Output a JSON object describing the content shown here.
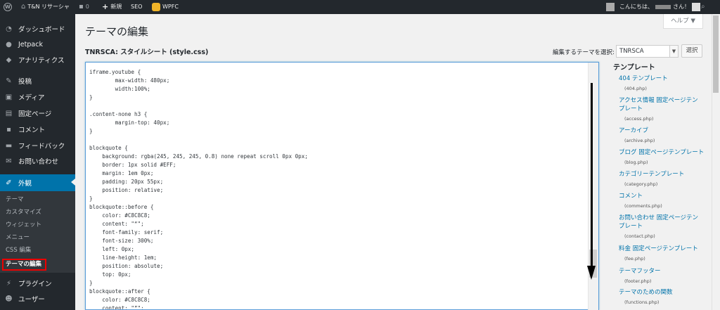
{
  "adminbar": {
    "site_name": "T&N リサーシャ",
    "comments_count": "0",
    "new_label": "新規",
    "seo_label": "SEO",
    "wpfc_label": "WPFC",
    "greeting": "こんにちは、",
    "greeting_suffix": "さん！"
  },
  "sidebar": {
    "dashboard": "ダッシュボード",
    "jetpack": "Jetpack",
    "analytics": "アナリティクス",
    "posts": "投稿",
    "media": "メディア",
    "pages": "固定ページ",
    "comments": "コメント",
    "feedback": "フィードバック",
    "contact": "お問い合わせ",
    "appearance": "外観",
    "sub": [
      "テーマ",
      "カスタマイズ",
      "ウィジェット",
      "メニュー",
      "CSS 編集",
      "テーマの編集"
    ],
    "plugins": "プラグイン",
    "users": "ユーザー"
  },
  "main": {
    "title": "テーマの編集",
    "help": "ヘルプ ▼",
    "file_heading": "TNRSCA: スタイルシート (style.css)",
    "select_label": "編集するテーマを選択:",
    "selected_theme": "TNRSCA",
    "select_button": "選択"
  },
  "editor": {
    "lines": [
      "iframe.youtube {",
      "        max-width: 480px;",
      "        width:100%;",
      "}",
      "",
      ".content-none h3 {",
      "        margin-top: 40px;",
      "}",
      "",
      "blockquote {",
      "    background: rgba(245, 245, 245, 0.8) none repeat scroll 0px 0px;",
      "    border: 1px solid #EFF;",
      "    margin: 1em 0px;",
      "    padding: 20px 55px;",
      "    position: relative;",
      "}",
      "blockquote::before {",
      "    color: #C8C8C8;",
      "    content: \"“\";",
      "    font-family: serif;",
      "    font-size: 300%;",
      "    left: 0px;",
      "    line-height: 1em;",
      "    position: absolute;",
      "    top: 0px;",
      "}",
      "blockquote::after {",
      "    color: #C8C8C8;",
      "    content: \"”\";"
    ]
  },
  "templates": {
    "heading": "テンプレート",
    "items": [
      {
        "name": "404 テンプレート",
        "file": "(404.php)"
      },
      {
        "name": "アクセス情報 固定ページテンプレート",
        "file": "(access.php)"
      },
      {
        "name": "アーカイブ",
        "file": "(archive.php)"
      },
      {
        "name": "ブログ 固定ページテンプレート",
        "file": "(blog.php)"
      },
      {
        "name": "カテゴリーテンプレート",
        "file": "(category.php)"
      },
      {
        "name": "コメント",
        "file": "(comments.php)"
      },
      {
        "name": "お問い合わせ 固定ページテンプレート",
        "file": "(contact.php)"
      },
      {
        "name": "料金 固定ページテンプレート",
        "file": "(fee.php)"
      },
      {
        "name": "テーマフッター",
        "file": "(footer.php)"
      },
      {
        "name": "テーマのための関数",
        "file": "(functions.php)"
      }
    ]
  }
}
